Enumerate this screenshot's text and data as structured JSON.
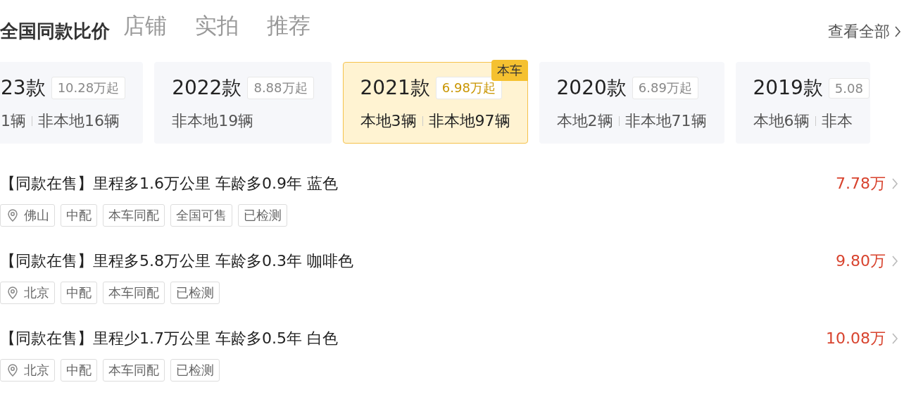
{
  "tabs": [
    {
      "label": "店铺",
      "selected": false
    },
    {
      "label": "实拍",
      "selected": false
    },
    {
      "label": "推荐",
      "selected": false
    }
  ],
  "section": {
    "title": "全国同款比价",
    "view_all": "查看全部"
  },
  "years": [
    {
      "year": "23款",
      "price": "10.28万起",
      "local": "1辆",
      "nonlocal": "非本地16辆",
      "selected": false
    },
    {
      "year": "2022款",
      "price": "8.88万起",
      "nonlocal": "非本地19辆",
      "selected": false
    },
    {
      "year": "2021款",
      "price": "6.98万起",
      "local": "本地3辆",
      "nonlocal": "非本地97辆",
      "selected": true,
      "badge": "本车"
    },
    {
      "year": "2020款",
      "price": "6.89万起",
      "local": "本地2辆",
      "nonlocal": "非本地71辆",
      "selected": false
    },
    {
      "year": "2019款",
      "price": "5.08",
      "local": "本地6辆",
      "nonlocal": "非本",
      "selected": false
    }
  ],
  "listings": [
    {
      "title": "【同款在售】里程多1.6万公里 车龄多0.9年 蓝色",
      "price": "7.78万",
      "city": "佛山",
      "tags": [
        "中配",
        "本车同配",
        "全国可售",
        "已检测"
      ]
    },
    {
      "title": "【同款在售】里程多5.8万公里 车龄多0.3年 咖啡色",
      "price": "9.80万",
      "city": "北京",
      "tags": [
        "中配",
        "本车同配",
        "已检测"
      ]
    },
    {
      "title": "【同款在售】里程少1.7万公里 车龄多0.5年 白色",
      "price": "10.08万",
      "city": "北京",
      "tags": [
        "中配",
        "本车同配",
        "已检测"
      ]
    }
  ]
}
